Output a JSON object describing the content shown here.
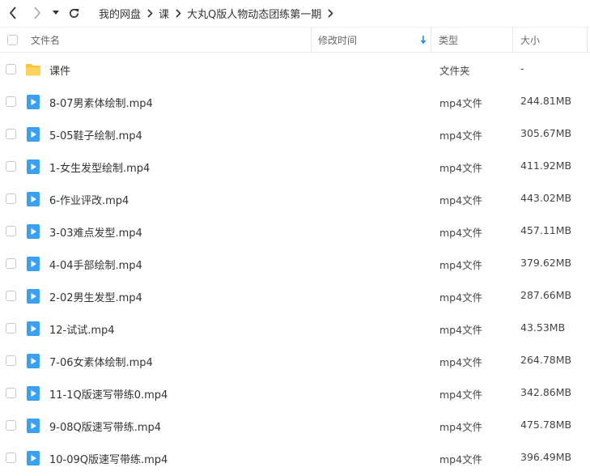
{
  "breadcrumb": [
    "我的网盘",
    "课",
    "大丸Q版人物动态团练第一期"
  ],
  "columns": {
    "name": "文件名",
    "mtime": "修改时间",
    "type": "类型",
    "size": "大小"
  },
  "files": [
    {
      "name": "课件",
      "icon": "folder-icon",
      "mtime": "",
      "type": "文件夹",
      "size": "-"
    },
    {
      "name": "8-07男素体绘制.mp4",
      "icon": "video-file-icon",
      "mtime": "",
      "type": "mp4文件",
      "size": "244.81MB"
    },
    {
      "name": "5-05鞋子绘制.mp4",
      "icon": "video-file-icon",
      "mtime": "",
      "type": "mp4文件",
      "size": "305.67MB"
    },
    {
      "name": "1-女生发型绘制.mp4",
      "icon": "video-file-icon",
      "mtime": "",
      "type": "mp4文件",
      "size": "411.92MB"
    },
    {
      "name": "6-作业评改.mp4",
      "icon": "video-file-icon",
      "mtime": "",
      "type": "mp4文件",
      "size": "443.02MB"
    },
    {
      "name": "3-03难点发型.mp4",
      "icon": "video-file-icon",
      "mtime": "",
      "type": "mp4文件",
      "size": "457.11MB"
    },
    {
      "name": "4-04手部绘制.mp4",
      "icon": "video-file-icon",
      "mtime": "",
      "type": "mp4文件",
      "size": "379.62MB"
    },
    {
      "name": "2-02男生发型.mp4",
      "icon": "video-file-icon",
      "mtime": "",
      "type": "mp4文件",
      "size": "287.66MB"
    },
    {
      "name": "12-试试.mp4",
      "icon": "video-file-icon",
      "mtime": "",
      "type": "mp4文件",
      "size": "43.53MB"
    },
    {
      "name": "7-06女素体绘制.mp4",
      "icon": "video-file-icon",
      "mtime": "",
      "type": "mp4文件",
      "size": "264.78MB"
    },
    {
      "name": "11-1Q版速写带练0.mp4",
      "icon": "video-file-icon",
      "mtime": "",
      "type": "mp4文件",
      "size": "342.86MB"
    },
    {
      "name": "9-08Q版速写带练.mp4",
      "icon": "video-file-icon",
      "mtime": "",
      "type": "mp4文件",
      "size": "475.78MB"
    },
    {
      "name": "10-09Q版速写带练.mp4",
      "icon": "video-file-icon",
      "mtime": "",
      "type": "mp4文件",
      "size": "396.49MB"
    }
  ],
  "colors": {
    "accent": "#2d8cf0",
    "folder": "#ffc533",
    "video": "#3aa0f3"
  }
}
